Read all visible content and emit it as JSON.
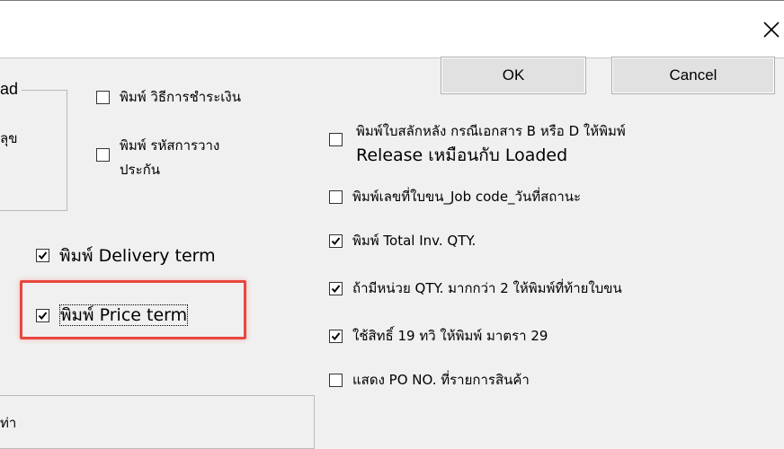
{
  "titlebar": {
    "close_icon": "close-icon"
  },
  "buttons": {
    "ok": "OK",
    "cancel": "Cancel"
  },
  "left_group": {
    "label_fragment": "ad",
    "content_fragment": "ลุข"
  },
  "bottom_group": {
    "label_fragment": "ท่า"
  },
  "checkboxes": [
    {
      "id": "print_payment_method",
      "label": "พิมพ์ วิธีการชำระเงิน",
      "checked": false
    },
    {
      "id": "print_deposit_code",
      "label_line1": "พิมพ์ รหัสการวาง",
      "label_line2": "ประกัน",
      "checked": false
    },
    {
      "id": "print_delivery_term",
      "label": "พิมพ์ Delivery term",
      "checked": true
    },
    {
      "id": "print_price_term",
      "label": "พิมพ์ Price term",
      "checked": true
    },
    {
      "id": "print_back_label",
      "label_line1": "พิมพ์ใบสลักหลัง กรณีเอกสาร B หรือ D ให้พิมพ์",
      "label_line2": "Release เหมือนกับ Loaded",
      "checked": false
    },
    {
      "id": "print_waybill_no",
      "label": "พิมพ์เลขที่ใบขน_Job code_วันที่สถานะ",
      "checked": false
    },
    {
      "id": "print_total_qty",
      "label": "พิมพ์ Total Inv. QTY.",
      "checked": true
    },
    {
      "id": "print_qty_end",
      "label": "ถ้ามีหน่วย QTY. มากกว่า 2 ให้พิมพ์ที่ท้ายใบขน",
      "checked": true
    },
    {
      "id": "use_right_19",
      "label": "ใช้สิทธิ์ 19 ทวิ ให้พิมพ์ มาตรา 29",
      "checked": true
    },
    {
      "id": "show_po_no",
      "label": "แสดง PO NO. ที่รายการสินค้า",
      "checked": false
    }
  ],
  "colors": {
    "highlight": "#e8473f",
    "background": "#f0f0f0"
  }
}
